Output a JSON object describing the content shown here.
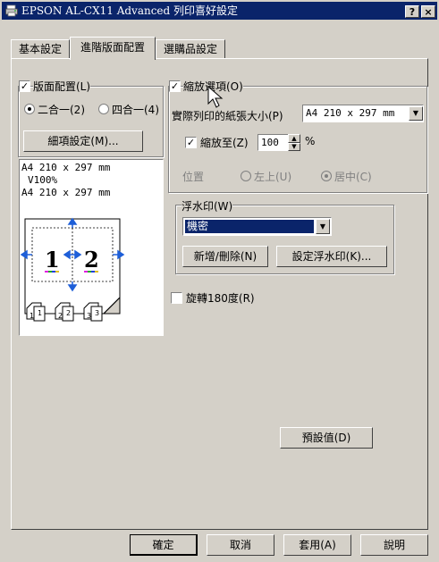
{
  "window": {
    "title": "EPSON AL-CX11 Advanced 列印喜好設定",
    "help_btn": "?",
    "close_btn": "×"
  },
  "tabs": [
    {
      "label": "基本設定"
    },
    {
      "label": "進階版面配置"
    },
    {
      "label": "選購品設定"
    }
  ],
  "layout": {
    "label": "版面配置(L)",
    "checked": true,
    "radio_2up": "二合一(2)",
    "radio_4up": "四合一(4)",
    "selected": "二合一(2)",
    "detail_button": "細項設定(M)..."
  },
  "preview": {
    "line1": "A4 210 x 297 mm",
    "line2": "V100%",
    "line3": "A4 210 x 297 mm",
    "page_nums": [
      "1",
      "2"
    ],
    "small_nums": [
      "1",
      "2",
      "3"
    ]
  },
  "zoom": {
    "label": "縮放選項(O)",
    "checked": true,
    "paper_label": "實際列印的紙張大小(P)",
    "paper_value": "A4 210 x 297 mm",
    "scale_label": "縮放至(Z)",
    "scale_checked": true,
    "scale_value": "100",
    "percent": "%",
    "position_label": "位置",
    "pos_topleft": "左上(U)",
    "pos_center": "居中(C)",
    "pos_selected": "居中(C)"
  },
  "watermark": {
    "label": "浮水印(W)",
    "selected": "機密",
    "add_delete_button": "新增/刪除(N)",
    "settings_button": "設定浮水印(K)..."
  },
  "rotate": {
    "label": "旋轉180度(R)",
    "checked": false
  },
  "defaults_button": "預設值(D)",
  "footer": {
    "ok": "確定",
    "cancel": "取消",
    "apply": "套用(A)",
    "help": "說明"
  },
  "colors": {
    "title_bg": "#0a246a",
    "face": "#d4d0c8",
    "selection": "#0a246a",
    "arrow_blue": "#1e5fd8"
  }
}
